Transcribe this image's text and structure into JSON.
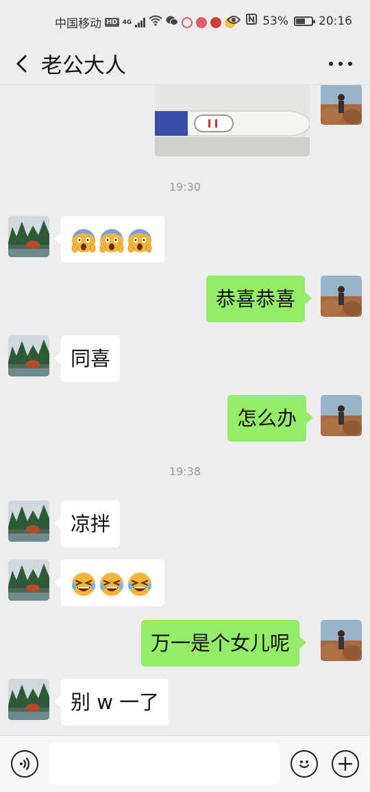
{
  "status_bar": {
    "carrier": "中国移动",
    "hd": "HD",
    "network": "4G",
    "battery": "53%",
    "battery_level": 0.53,
    "time": "20:16"
  },
  "header": {
    "back_icon": "chevron-left-icon",
    "title": "老公大人",
    "more_icon": "more-dots-icon"
  },
  "chat": {
    "timestamps": [
      "19:30",
      "19:38"
    ],
    "messages": [
      {
        "side": "right",
        "type": "image",
        "content": "pregnancy-test-photo"
      },
      {
        "side": "left",
        "type": "emoji",
        "content": "scream-emoji x3"
      },
      {
        "side": "right",
        "type": "text",
        "text": "恭喜恭喜"
      },
      {
        "side": "left",
        "type": "text",
        "text": "同喜"
      },
      {
        "side": "right",
        "type": "text",
        "text": "怎么办"
      },
      {
        "side": "left",
        "type": "text",
        "text": "凉拌"
      },
      {
        "side": "left",
        "type": "emoji",
        "content": "laughing-crying-emoji x3"
      },
      {
        "side": "right",
        "type": "text",
        "text": "万一是个女儿呢"
      },
      {
        "side": "left",
        "type": "text",
        "text": "别 w 一了"
      }
    ]
  },
  "input_bar": {
    "voice_icon": "voice-icon",
    "input_value": "",
    "emoji_icon": "smiley-icon",
    "plus_icon": "plus-icon"
  },
  "colors": {
    "background": "#ededed",
    "sent_bubble": "#95ec69",
    "received_bubble": "#ffffff",
    "timestamp": "#9a9a9a"
  }
}
